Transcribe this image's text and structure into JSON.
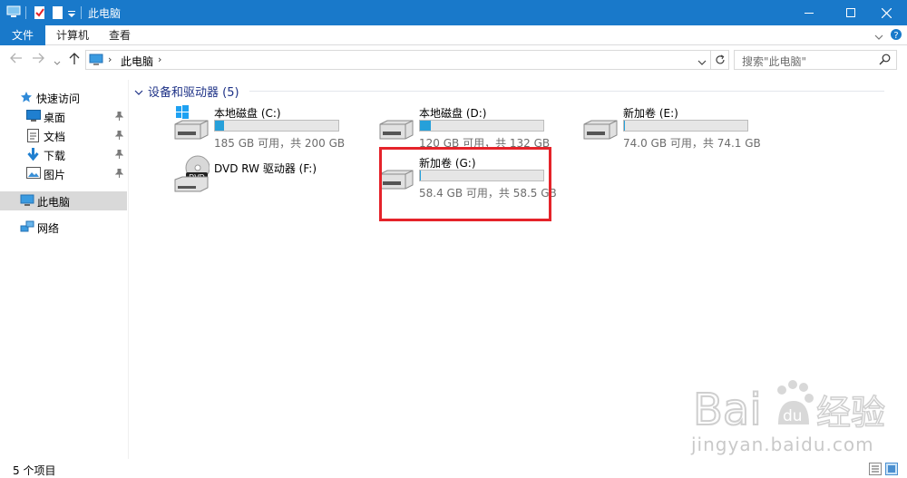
{
  "window": {
    "title": "此电脑",
    "accent": "#1979ca"
  },
  "ribbon": {
    "tabs": [
      "文件",
      "计算机",
      "查看"
    ]
  },
  "address": {
    "path": "此电脑",
    "search_placeholder": "搜索\"此电脑\""
  },
  "sidebar": {
    "items": [
      {
        "label": "快速访问",
        "icon": "star-icon"
      },
      {
        "label": "桌面",
        "icon": "desktop-icon",
        "pinned": true
      },
      {
        "label": "文档",
        "icon": "documents-icon",
        "pinned": true
      },
      {
        "label": "下载",
        "icon": "download-icon",
        "pinned": true
      },
      {
        "label": "图片",
        "icon": "pictures-icon",
        "pinned": true
      },
      {
        "label": "此电脑",
        "icon": "computer-icon",
        "selected": true
      },
      {
        "label": "网络",
        "icon": "network-icon"
      }
    ]
  },
  "group": {
    "title": "设备和驱动器 (5)"
  },
  "drives": [
    {
      "name": "本地磁盘 (C:)",
      "size": "185 GB 可用，共 200 GB",
      "used_fraction": 0.075,
      "icon": "windows-drive-icon"
    },
    {
      "name": "本地磁盘 (D:)",
      "size": "120 GB 可用，共 132 GB",
      "used_fraction": 0.09,
      "icon": "hard-drive-icon"
    },
    {
      "name": "新加卷 (E:)",
      "size": "74.0 GB 可用，共 74.1 GB",
      "used_fraction": 0.001,
      "icon": "hard-drive-icon"
    },
    {
      "name": "DVD RW 驱动器 (F:)",
      "size": "",
      "icon": "dvd-drive-icon"
    },
    {
      "name": "新加卷 (G:)",
      "size": "58.4 GB 可用，共 58.5 GB",
      "used_fraction": 0.001,
      "icon": "hard-drive-icon",
      "highlighted": true
    }
  ],
  "status": {
    "text": "5 个项目"
  },
  "watermark": {
    "site": "jingyan.baidu.com"
  }
}
